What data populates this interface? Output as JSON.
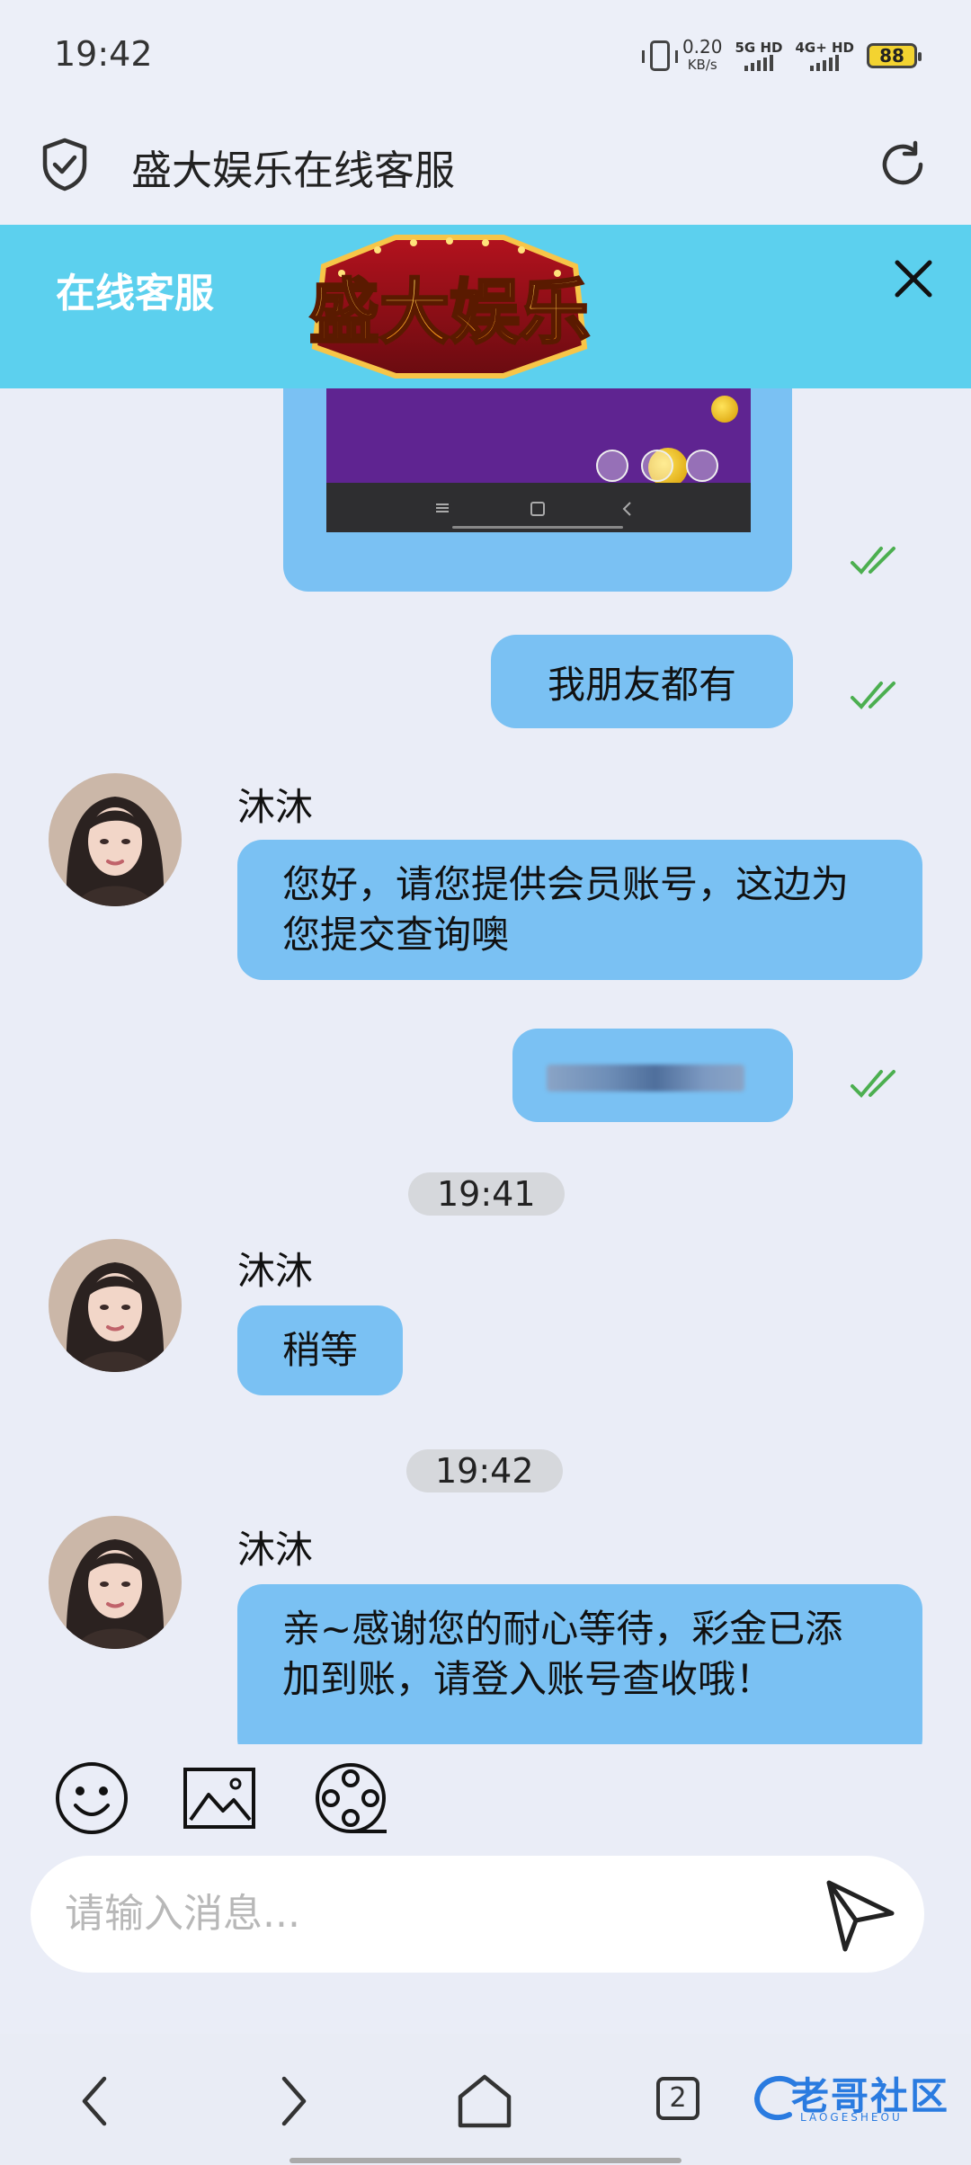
{
  "status": {
    "time": "19:42",
    "speed_value": "0.20",
    "speed_unit": "KB/s",
    "sim1": "5G HD",
    "sim2": "4G+ HD",
    "battery": "88"
  },
  "browser": {
    "page_title": "盛大娱乐在线客服"
  },
  "chat_header": {
    "label": "在线客服",
    "logo_text": "盛大娱乐"
  },
  "messages": {
    "sent_1": "我朋友都有",
    "agent_name": "沐沐",
    "recv_1": "您好，请您提供会员账号，这边为您提交查询噢",
    "time_1": "19:41",
    "recv_2": "稍等",
    "time_2": "19:42",
    "recv_3": "亲~感谢您的耐心等待，彩金已添加到账，请登入账号查收哦！"
  },
  "composer": {
    "placeholder": "请输入消息..."
  },
  "nav": {
    "tab_count": "2",
    "watermark": "老哥社区",
    "watermark_sub": "LAOGESHEOU"
  },
  "colors": {
    "header": "#5cd0ee",
    "bubble": "#7ac1f3",
    "background": "#eaedf7",
    "check": "#4caf50"
  }
}
